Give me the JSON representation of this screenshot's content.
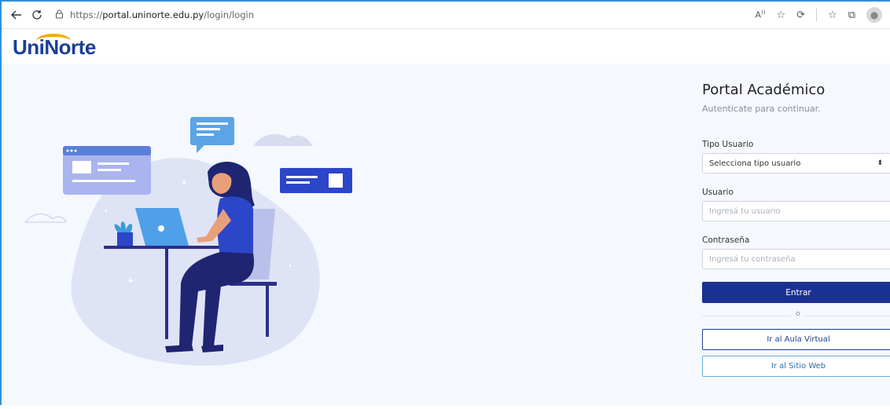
{
  "browser": {
    "url_scheme": "https://",
    "url_host": "portal.uninorte.edu.py",
    "url_path": "/login/login"
  },
  "site": {
    "logo_text": "UniNorte"
  },
  "login": {
    "title": "Portal Académico",
    "subtitle": "Autenticate para continuar.",
    "tipo_label": "Tipo Usuario",
    "tipo_value": "Selecciona tipo usuario",
    "usuario_label": "Usuario",
    "usuario_placeholder": "Ingresá tu usuario",
    "password_label": "Contraseña",
    "password_placeholder": "Ingresá tu contraseña",
    "submit_label": "Entrar",
    "divider_text": "o",
    "aula_label": "Ir al Aula Virtual",
    "sitio_label": "Ir al Sitio Web"
  },
  "colors": {
    "primary": "#1a3194",
    "logo_blue": "#1c3f94",
    "logo_accent": "#f4a81d",
    "background": "#f5f8fd"
  }
}
